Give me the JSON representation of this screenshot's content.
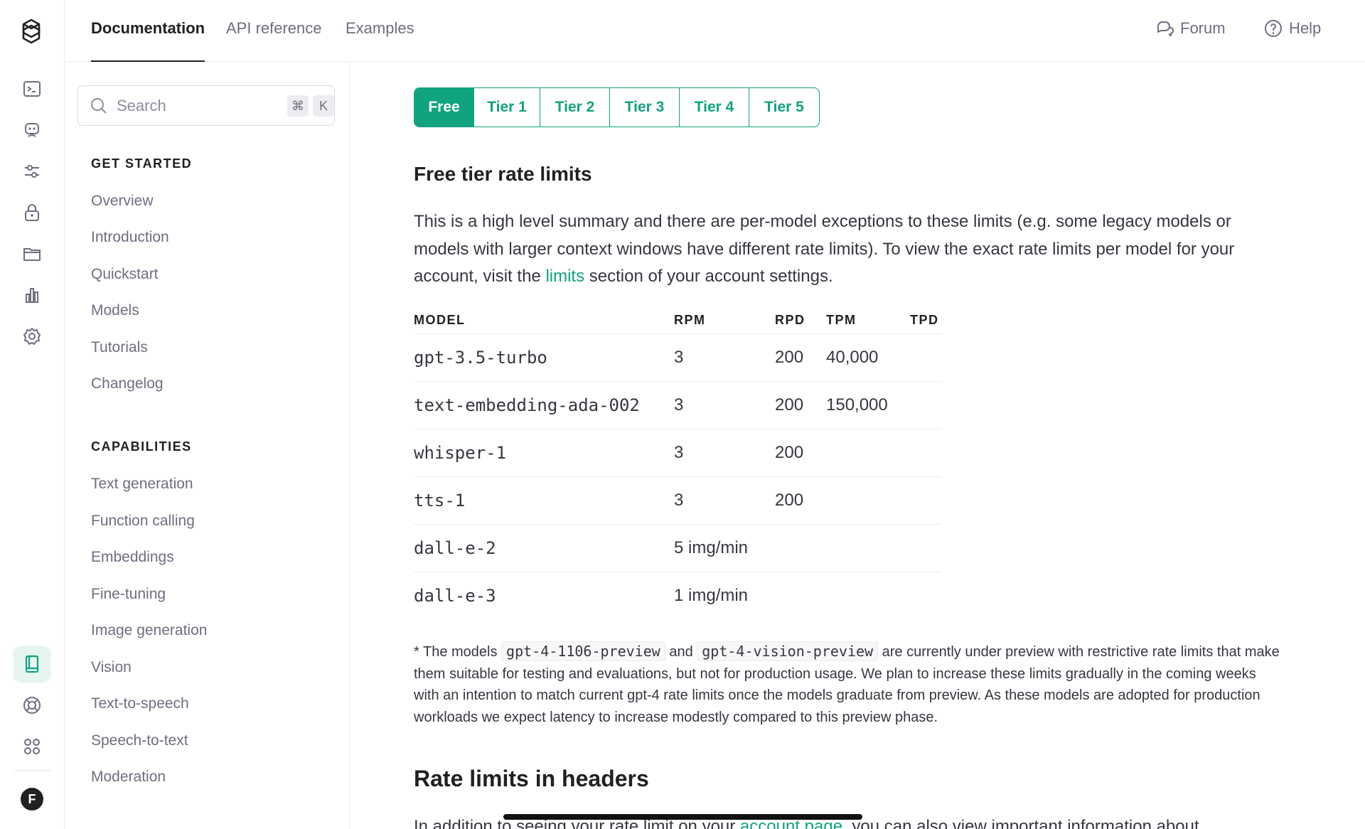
{
  "top_nav": {
    "tabs": [
      {
        "label": "Documentation",
        "active": true
      },
      {
        "label": "API reference",
        "active": false
      },
      {
        "label": "Examples",
        "active": false
      }
    ],
    "forum_label": "Forum",
    "help_label": "Help"
  },
  "rail": {
    "icons": [
      "terminal-icon",
      "assistant-bot-icon",
      "sliders-icon",
      "lock-icon",
      "folder-icon",
      "bar-chart-icon",
      "settings-gear-icon",
      "book-icon",
      "help-ring-icon",
      "apps-grid-icon"
    ],
    "active_icon": "book-icon",
    "avatar_initial": "F",
    "accent_color": "#10a37f"
  },
  "sidebar": {
    "search": {
      "placeholder": "Search",
      "shortcut_keys": [
        "⌘",
        "K"
      ]
    },
    "sections": [
      {
        "title": "GET STARTED",
        "items": [
          "Overview",
          "Introduction",
          "Quickstart",
          "Models",
          "Tutorials",
          "Changelog"
        ]
      },
      {
        "title": "CAPABILITIES",
        "items": [
          "Text generation",
          "Function calling",
          "Embeddings",
          "Fine-tuning",
          "Image generation",
          "Vision",
          "Text-to-speech",
          "Speech-to-text",
          "Moderation"
        ]
      }
    ]
  },
  "content": {
    "tiers": [
      {
        "label": "Free",
        "active": true
      },
      {
        "label": "Tier 1",
        "active": false
      },
      {
        "label": "Tier 2",
        "active": false
      },
      {
        "label": "Tier 3",
        "active": false
      },
      {
        "label": "Tier 4",
        "active": false
      },
      {
        "label": "Tier 5",
        "active": false
      }
    ],
    "subheading": "Free tier rate limits",
    "intro": {
      "before_link": "This is a high level summary and there are per-model exceptions to these limits (e.g. some legacy models or models with larger context windows have different rate limits). To view the exact rate limits per model for your account, visit the ",
      "link_text": "limits",
      "after_link": " section of your account settings."
    },
    "table": {
      "headers": [
        "MODEL",
        "RPM",
        "RPD",
        "TPM",
        "TPD"
      ],
      "rows": [
        {
          "model": "gpt-3.5-turbo",
          "rpm": "3",
          "rpd": "200",
          "tpm": "40,000",
          "tpd": ""
        },
        {
          "model": "text-embedding-ada-002",
          "rpm": "3",
          "rpd": "200",
          "tpm": "150,000",
          "tpd": ""
        },
        {
          "model": "whisper-1",
          "rpm": "3",
          "rpd": "200",
          "tpm": "",
          "tpd": ""
        },
        {
          "model": "tts-1",
          "rpm": "3",
          "rpd": "200",
          "tpm": "",
          "tpd": ""
        },
        {
          "model": "dall-e-2",
          "rpm": "5 img/min",
          "rpd": "",
          "tpm": "",
          "tpd": ""
        },
        {
          "model": "dall-e-3",
          "rpm": "1 img/min",
          "rpd": "",
          "tpm": "",
          "tpd": ""
        }
      ]
    },
    "note": {
      "prefix": "* The models ",
      "code1": "gpt-4-1106-preview",
      "mid": " and ",
      "code2": "gpt-4-vision-preview",
      "suffix": " are currently under preview with restrictive rate limits that make them suitable for testing and evaluations, but not for production usage. We plan to increase these limits gradually in the coming weeks with an intention to match current gpt-4 rate limits once the models graduate from preview. As these models are adopted for production workloads we expect latency to increase modestly compared to this preview phase."
    },
    "heading2": "Rate limits in headers",
    "cut_para": {
      "before_link": "In addition to seeing your rate limit on your ",
      "link_text": "account page",
      "after_link": ", you can also view important information about"
    }
  }
}
